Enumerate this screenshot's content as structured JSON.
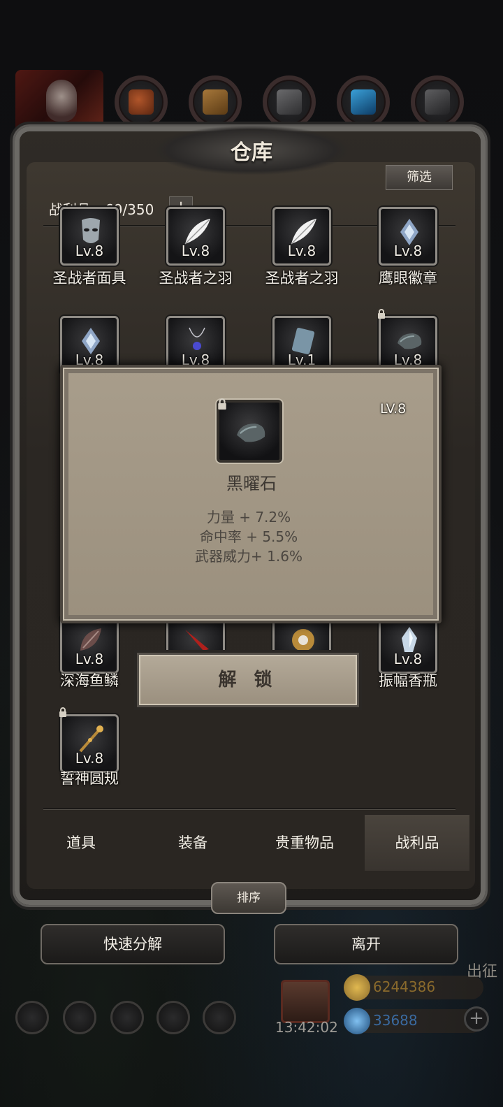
{
  "header": {
    "title": "仓库",
    "filter_label": "筛选",
    "loot_count": "战利品：69/350",
    "add_label": "+"
  },
  "grid": {
    "row1": [
      {
        "lv": "Lv.8",
        "name": "圣战者面具",
        "icon": "mask-icon"
      },
      {
        "lv": "Lv.8",
        "name": "圣战者之羽",
        "icon": "feather-icon"
      },
      {
        "lv": "Lv.8",
        "name": "圣战者之羽",
        "icon": "feather-icon"
      },
      {
        "lv": "Lv.8",
        "name": "鹰眼徽章",
        "icon": "badge-icon"
      }
    ],
    "row2": [
      {
        "lv": "Lv.8",
        "icon": "badge-icon"
      },
      {
        "lv": "Lv.8",
        "icon": "necklace-icon"
      },
      {
        "lv": "Lv.1",
        "icon": "book-icon"
      },
      {
        "lv": "Lv.8",
        "icon": "obsidian-icon"
      }
    ],
    "row3": [
      {
        "lv": "Lv.8",
        "name": "深海鱼鳞",
        "icon": "scale-icon"
      },
      {
        "lv": "",
        "icon": "blade-icon"
      },
      {
        "lv": "",
        "icon": "sun-emblem-icon"
      },
      {
        "lv": "Lv.8",
        "name": "振幅香瓶",
        "icon": "crystal-bottle-icon"
      }
    ],
    "row4": [
      {
        "lv": "Lv.8",
        "name": "誓神圆规",
        "icon": "staff-icon"
      }
    ]
  },
  "tooltip": {
    "level": "LV.8",
    "name": "黑曜石",
    "stats": [
      "力量 + 7.2%",
      "命中率 + 5.5%",
      "武器威力+ 1.6%"
    ],
    "icon": "obsidian-icon"
  },
  "unlock_label": "解 锁",
  "tabs": [
    "道具",
    "装备",
    "贵重物品",
    "战利品"
  ],
  "active_tab": "战利品",
  "sort_label": "排序",
  "buttons": {
    "decompose": "快速分解",
    "leave": "离开"
  },
  "hud": {
    "time": "13:42:02",
    "gold": "6244386",
    "gems": "33688",
    "sortie": "出征",
    "gold_color": "#8a6a2c",
    "gem_color": "#3a6aa0"
  }
}
